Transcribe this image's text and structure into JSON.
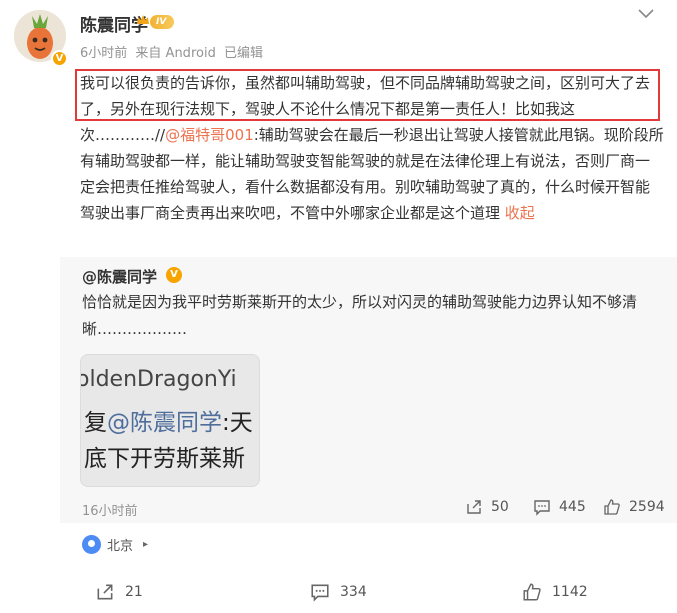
{
  "post": {
    "username": "陈震同学",
    "level_badge": "IV",
    "verified_mark": "V",
    "time": "6小时前",
    "source": "来自 Android",
    "edited": "已编辑",
    "text_part1": "我可以很负责的告诉你，虽然都叫辅助驾驶，但不同品牌辅助驾驶之间，区别可大了去了，另外在现行法规下，驾驶人不论什么情况下都是第一责任人！比如我这次…………//",
    "mention": "@福特哥001",
    "text_part2": ":辅助驾驶会在最后一秒退出让驾驶人接管就此甩锅。现阶段所有辅助驾驶都一样，能让辅助驾驶变智能驾驶的就是在法律伦理上有说法，否则厂商一定会把责任推给驾驶人，看什么数据都没有用。别吹辅助驾驶了真的，什么时候开智能驾驶出事厂商全责再出来吹吧，不管中外哪家企业都是这个道理",
    "fold_label": "收起"
  },
  "repost": {
    "username": "@陈震同学",
    "verified_mark": "V",
    "text": "恰恰就是因为我平时劳斯莱斯开的太少，所以对闪灵的辅助驾驶能力边界认知不够清晰………………",
    "image_line1": "oldenDragonYi",
    "image_line2_prefix": "复",
    "image_line2_mention": "@陈震同学",
    "image_line2_suffix": ":天",
    "image_line3": "底下开劳斯莱斯",
    "time": "16小时前",
    "reposts": "50",
    "comments": "445",
    "likes": "2594"
  },
  "location": {
    "name": "北京",
    "arrow": "▸"
  },
  "footer": {
    "reposts": "21",
    "comments": "334",
    "likes": "1142"
  },
  "colors": {
    "accent_orange": "#eb7350",
    "highlight_red": "#e23a3a",
    "location_blue": "#4d8bf5",
    "badge_gold": "#f7a400"
  },
  "icons": {
    "more": "chevron-down-icon",
    "share": "share-icon",
    "comment": "comment-icon",
    "like": "thumbs-up-icon",
    "location": "location-pin-icon"
  }
}
